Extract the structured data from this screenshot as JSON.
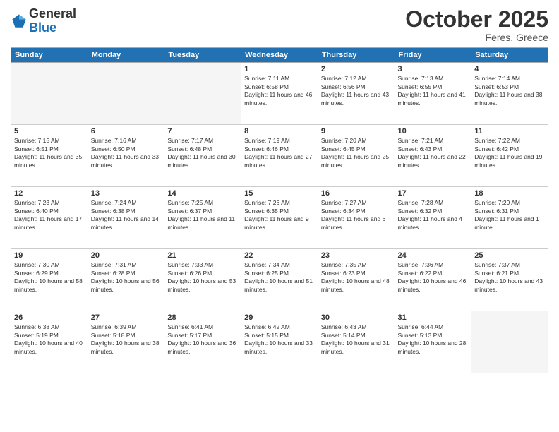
{
  "header": {
    "logo": {
      "general": "General",
      "blue": "Blue"
    },
    "title": "October 2025",
    "location": "Feres, Greece"
  },
  "weekdays": [
    "Sunday",
    "Monday",
    "Tuesday",
    "Wednesday",
    "Thursday",
    "Friday",
    "Saturday"
  ],
  "weeks": [
    [
      {
        "day": null
      },
      {
        "day": null
      },
      {
        "day": null
      },
      {
        "day": 1,
        "sunrise": "7:11 AM",
        "sunset": "6:58 PM",
        "daylight": "11 hours and 46 minutes."
      },
      {
        "day": 2,
        "sunrise": "7:12 AM",
        "sunset": "6:56 PM",
        "daylight": "11 hours and 43 minutes."
      },
      {
        "day": 3,
        "sunrise": "7:13 AM",
        "sunset": "6:55 PM",
        "daylight": "11 hours and 41 minutes."
      },
      {
        "day": 4,
        "sunrise": "7:14 AM",
        "sunset": "6:53 PM",
        "daylight": "11 hours and 38 minutes."
      }
    ],
    [
      {
        "day": 5,
        "sunrise": "7:15 AM",
        "sunset": "6:51 PM",
        "daylight": "11 hours and 35 minutes."
      },
      {
        "day": 6,
        "sunrise": "7:16 AM",
        "sunset": "6:50 PM",
        "daylight": "11 hours and 33 minutes."
      },
      {
        "day": 7,
        "sunrise": "7:17 AM",
        "sunset": "6:48 PM",
        "daylight": "11 hours and 30 minutes."
      },
      {
        "day": 8,
        "sunrise": "7:19 AM",
        "sunset": "6:46 PM",
        "daylight": "11 hours and 27 minutes."
      },
      {
        "day": 9,
        "sunrise": "7:20 AM",
        "sunset": "6:45 PM",
        "daylight": "11 hours and 25 minutes."
      },
      {
        "day": 10,
        "sunrise": "7:21 AM",
        "sunset": "6:43 PM",
        "daylight": "11 hours and 22 minutes."
      },
      {
        "day": 11,
        "sunrise": "7:22 AM",
        "sunset": "6:42 PM",
        "daylight": "11 hours and 19 minutes."
      }
    ],
    [
      {
        "day": 12,
        "sunrise": "7:23 AM",
        "sunset": "6:40 PM",
        "daylight": "11 hours and 17 minutes."
      },
      {
        "day": 13,
        "sunrise": "7:24 AM",
        "sunset": "6:38 PM",
        "daylight": "11 hours and 14 minutes."
      },
      {
        "day": 14,
        "sunrise": "7:25 AM",
        "sunset": "6:37 PM",
        "daylight": "11 hours and 11 minutes."
      },
      {
        "day": 15,
        "sunrise": "7:26 AM",
        "sunset": "6:35 PM",
        "daylight": "11 hours and 9 minutes."
      },
      {
        "day": 16,
        "sunrise": "7:27 AM",
        "sunset": "6:34 PM",
        "daylight": "11 hours and 6 minutes."
      },
      {
        "day": 17,
        "sunrise": "7:28 AM",
        "sunset": "6:32 PM",
        "daylight": "11 hours and 4 minutes."
      },
      {
        "day": 18,
        "sunrise": "7:29 AM",
        "sunset": "6:31 PM",
        "daylight": "11 hours and 1 minute."
      }
    ],
    [
      {
        "day": 19,
        "sunrise": "7:30 AM",
        "sunset": "6:29 PM",
        "daylight": "10 hours and 58 minutes."
      },
      {
        "day": 20,
        "sunrise": "7:31 AM",
        "sunset": "6:28 PM",
        "daylight": "10 hours and 56 minutes."
      },
      {
        "day": 21,
        "sunrise": "7:33 AM",
        "sunset": "6:26 PM",
        "daylight": "10 hours and 53 minutes."
      },
      {
        "day": 22,
        "sunrise": "7:34 AM",
        "sunset": "6:25 PM",
        "daylight": "10 hours and 51 minutes."
      },
      {
        "day": 23,
        "sunrise": "7:35 AM",
        "sunset": "6:23 PM",
        "daylight": "10 hours and 48 minutes."
      },
      {
        "day": 24,
        "sunrise": "7:36 AM",
        "sunset": "6:22 PM",
        "daylight": "10 hours and 46 minutes."
      },
      {
        "day": 25,
        "sunrise": "7:37 AM",
        "sunset": "6:21 PM",
        "daylight": "10 hours and 43 minutes."
      }
    ],
    [
      {
        "day": 26,
        "sunrise": "6:38 AM",
        "sunset": "5:19 PM",
        "daylight": "10 hours and 40 minutes."
      },
      {
        "day": 27,
        "sunrise": "6:39 AM",
        "sunset": "5:18 PM",
        "daylight": "10 hours and 38 minutes."
      },
      {
        "day": 28,
        "sunrise": "6:41 AM",
        "sunset": "5:17 PM",
        "daylight": "10 hours and 36 minutes."
      },
      {
        "day": 29,
        "sunrise": "6:42 AM",
        "sunset": "5:15 PM",
        "daylight": "10 hours and 33 minutes."
      },
      {
        "day": 30,
        "sunrise": "6:43 AM",
        "sunset": "5:14 PM",
        "daylight": "10 hours and 31 minutes."
      },
      {
        "day": 31,
        "sunrise": "6:44 AM",
        "sunset": "5:13 PM",
        "daylight": "10 hours and 28 minutes."
      },
      {
        "day": null
      }
    ]
  ]
}
